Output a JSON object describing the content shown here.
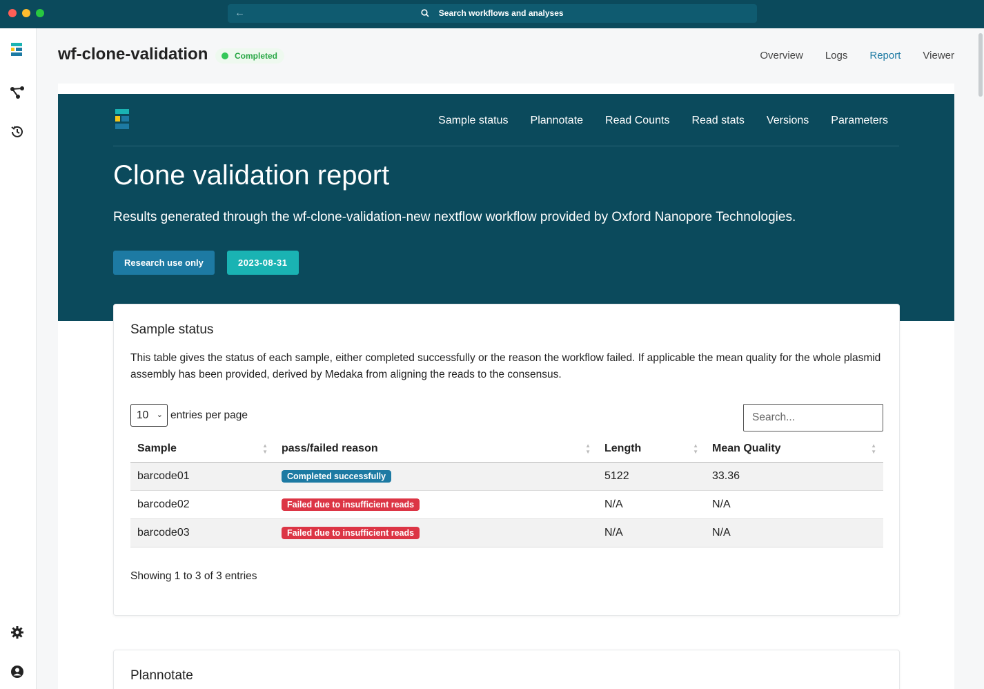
{
  "titlebar": {
    "search_label": "Search workflows and analyses"
  },
  "app": {
    "title": "wf-clone-validation",
    "status": "Completed",
    "status_color": "#34c759",
    "tabs": [
      {
        "label": "Overview",
        "active": false
      },
      {
        "label": "Logs",
        "active": false
      },
      {
        "label": "Report",
        "active": true
      },
      {
        "label": "Viewer",
        "active": false
      }
    ],
    "rail_icons": [
      "epi2me-logo-icon",
      "workflow-icon",
      "history-icon",
      "settings-icon",
      "account-icon"
    ]
  },
  "report": {
    "nav": [
      "Sample status",
      "Plannotate",
      "Read Counts",
      "Read stats",
      "Versions",
      "Parameters"
    ],
    "title": "Clone validation report",
    "subtitle": "Results generated through the wf-clone-validation-new nextflow workflow provided by Oxford Nanopore Technologies.",
    "research_badge": "Research use only",
    "date_badge": "2023-08-31",
    "colors": {
      "hero_bg": "#0b4a5c",
      "accent": "#1d7aa3",
      "teal": "#1ab3b3",
      "fail": "#dc3545"
    }
  },
  "sample_status": {
    "title": "Sample status",
    "description": "This table gives the status of each sample, either completed successfully or the reason the workflow failed. If applicable the mean quality for the whole plasmid assembly has been provided, derived by Medaka from aligning the reads to the consensus.",
    "entries_value": "10",
    "entries_label": "entries per page",
    "search_placeholder": "Search...",
    "columns": [
      "Sample",
      "pass/failed reason",
      "Length",
      "Mean Quality"
    ],
    "rows": [
      {
        "sample": "barcode01",
        "reason": "Completed successfully",
        "status": "ok",
        "length": "5122",
        "quality": "33.36"
      },
      {
        "sample": "barcode02",
        "reason": "Failed due to insufficient reads",
        "status": "fail",
        "length": "N/A",
        "quality": "N/A"
      },
      {
        "sample": "barcode03",
        "reason": "Failed due to insufficient reads",
        "status": "fail",
        "length": "N/A",
        "quality": "N/A"
      }
    ],
    "info": "Showing 1 to 3 of 3 entries"
  },
  "plannotate": {
    "title": "Plannotate"
  }
}
